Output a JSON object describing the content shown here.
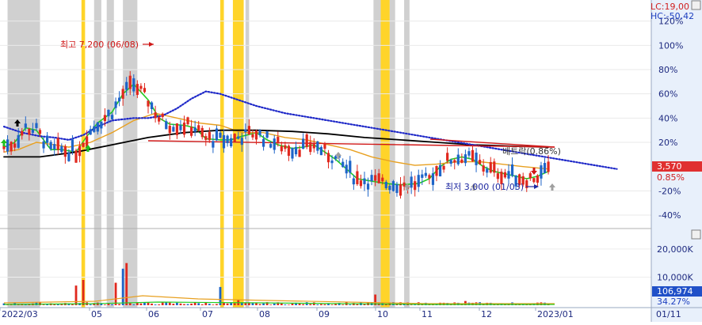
{
  "header": {
    "lc_label": "LC:19,00",
    "hc_label": "HC:-50,42"
  },
  "colors": {
    "background": "#ffffff",
    "shade_gray": "#c8c8c8",
    "shade_yellow": "#ffd21e",
    "axis_panel": "#e8f0fb",
    "candle_up": "#e0281e",
    "candle_down": "#1e64c8",
    "ma_green": "#22cc22",
    "ma_orange": "#e8a020",
    "ma_black": "#000000",
    "ma_blue": "#1e28c8",
    "trend_red": "#d01818",
    "price_badge": "#e03030",
    "volume_badge": "#2050c8"
  },
  "annotations": {
    "high_label": "최고 7,200 (06/08)",
    "low_label": "최저 3,000 (01/03)",
    "ratio_label": "배트락(0.86%)"
  },
  "badges": {
    "price_value": "3,570",
    "price_pct": "0.85%",
    "volume_value": "106,974",
    "volume_pct": "34.27%"
  },
  "chart_data": {
    "type": "candlestick",
    "title": "",
    "x_ticks": [
      "2022/03",
      "05",
      "06",
      "07",
      "08",
      "09",
      "10",
      "11",
      "12",
      "2023/01",
      "01/11"
    ],
    "price_axis": {
      "ticks": [
        "120%",
        "100%",
        "80%",
        "60%",
        "40%",
        "20%",
        "-20%",
        "-40%"
      ],
      "range_pct": [
        -50,
        120
      ]
    },
    "volume_axis": {
      "ticks": [
        "20,000K",
        "10,000K"
      ],
      "range_k": [
        0,
        27000
      ]
    },
    "moving_averages": [
      {
        "color": "green",
        "points": [
          [
            0,
            16
          ],
          [
            3,
            20
          ],
          [
            6,
            32
          ],
          [
            9,
            30
          ],
          [
            13,
            14
          ],
          [
            16,
            14
          ],
          [
            20,
            12
          ],
          [
            23,
            25
          ],
          [
            26,
            36
          ],
          [
            30,
            45
          ],
          [
            33,
            60
          ],
          [
            36,
            68
          ],
          [
            40,
            55
          ],
          [
            43,
            40
          ],
          [
            46,
            35
          ],
          [
            50,
            34
          ],
          [
            53,
            32
          ],
          [
            56,
            23
          ],
          [
            60,
            22
          ],
          [
            63,
            22
          ],
          [
            66,
            25
          ],
          [
            70,
            28
          ],
          [
            73,
            22
          ],
          [
            76,
            18
          ],
          [
            80,
            15
          ],
          [
            83,
            16
          ],
          [
            86,
            18
          ],
          [
            89,
            12
          ],
          [
            92,
            6
          ],
          [
            95,
            -2
          ],
          [
            98,
            -10
          ],
          [
            102,
            -12
          ],
          [
            106,
            -14
          ],
          [
            110,
            -15
          ],
          [
            115,
            -14
          ],
          [
            118,
            -10
          ],
          [
            121,
            0
          ],
          [
            124,
            6
          ],
          [
            127,
            8
          ],
          [
            130,
            6
          ],
          [
            133,
            0
          ],
          [
            136,
            -4
          ],
          [
            139,
            -6
          ],
          [
            142,
            -8
          ],
          [
            145,
            -10
          ],
          [
            148,
            -8
          ],
          [
            151,
            -4
          ]
        ]
      },
      {
        "color": "orange",
        "points": [
          [
            0,
            12
          ],
          [
            4,
            14
          ],
          [
            9,
            20
          ],
          [
            14,
            18
          ],
          [
            18,
            16
          ],
          [
            24,
            20
          ],
          [
            30,
            28
          ],
          [
            36,
            38
          ],
          [
            42,
            44
          ],
          [
            48,
            40
          ],
          [
            54,
            36
          ],
          [
            60,
            34
          ],
          [
            66,
            28
          ],
          [
            72,
            28
          ],
          [
            78,
            24
          ],
          [
            84,
            22
          ],
          [
            90,
            18
          ],
          [
            96,
            14
          ],
          [
            102,
            8
          ],
          [
            108,
            4
          ],
          [
            114,
            1
          ],
          [
            120,
            2
          ],
          [
            126,
            4
          ],
          [
            132,
            4
          ],
          [
            138,
            2
          ],
          [
            144,
            0
          ],
          [
            151,
            -2
          ]
        ]
      },
      {
        "color": "black",
        "points": [
          [
            0,
            8
          ],
          [
            10,
            8
          ],
          [
            20,
            12
          ],
          [
            30,
            18
          ],
          [
            40,
            24
          ],
          [
            50,
            28
          ],
          [
            60,
            30
          ],
          [
            70,
            30
          ],
          [
            80,
            29
          ],
          [
            90,
            27
          ],
          [
            100,
            24
          ],
          [
            110,
            22
          ],
          [
            120,
            20
          ],
          [
            130,
            18
          ],
          [
            140,
            17
          ],
          [
            151,
            16
          ]
        ]
      },
      {
        "color": "blue",
        "points": [
          [
            0,
            33
          ],
          [
            5,
            28
          ],
          [
            10,
            25
          ],
          [
            14,
            24
          ],
          [
            18,
            22
          ],
          [
            22,
            26
          ],
          [
            26,
            33
          ],
          [
            30,
            38
          ],
          [
            36,
            40
          ],
          [
            40,
            40
          ],
          [
            44,
            42
          ],
          [
            48,
            48
          ],
          [
            52,
            56
          ],
          [
            56,
            62
          ],
          [
            60,
            60
          ],
          [
            64,
            56
          ],
          [
            70,
            50
          ],
          [
            78,
            44
          ],
          [
            86,
            40
          ],
          [
            94,
            36
          ],
          [
            102,
            32
          ],
          [
            110,
            28
          ],
          [
            118,
            24
          ],
          [
            126,
            20
          ],
          [
            134,
            16
          ],
          [
            142,
            12
          ],
          [
            150,
            8
          ],
          [
            158,
            4
          ],
          [
            164,
            1
          ],
          [
            170,
            -2
          ]
        ]
      }
    ],
    "shaded_periods": [
      {
        "color": "gray",
        "from": 1,
        "to": 10
      },
      {
        "color": "yellow",
        "from": 21.5,
        "to": 22.5
      },
      {
        "color": "gray",
        "from": 25,
        "to": 27
      },
      {
        "color": "gray",
        "from": 28.5,
        "to": 30.5
      },
      {
        "color": "gray",
        "from": 33,
        "to": 37
      },
      {
        "color": "yellow",
        "from": 60,
        "to": 61
      },
      {
        "color": "yellow",
        "from": 63.5,
        "to": 66.5
      },
      {
        "color": "gray",
        "from": 67,
        "to": 68
      },
      {
        "color": "gray",
        "from": 102.5,
        "to": 104.5
      },
      {
        "color": "yellow",
        "from": 104.5,
        "to": 107
      },
      {
        "color": "gray",
        "from": 107,
        "to": 108.5
      },
      {
        "color": "gray",
        "from": 111,
        "to": 112.5
      }
    ],
    "high": {
      "label": "최고 7,200 (06/08)",
      "value_pct": 100
    },
    "low": {
      "label": "최저 3,000 (01/03)",
      "value_pct": -15
    },
    "last": {
      "price": "3,570",
      "pct": "0.85%",
      "volume": "106,974",
      "volume_pct": "34.27%"
    },
    "volume_spikes": [
      {
        "index": 20,
        "value_k": 7000
      },
      {
        "index": 22,
        "value_k": 9000
      },
      {
        "index": 31,
        "value_k": 8000
      },
      {
        "index": 33,
        "value_k": 13000
      },
      {
        "index": 34,
        "value_k": 15000
      },
      {
        "index": 60,
        "value_k": 6500
      },
      {
        "index": 65,
        "value_k": 2000
      },
      {
        "index": 103,
        "value_k": 3800
      },
      {
        "index": 128,
        "value_k": 1500
      }
    ]
  }
}
